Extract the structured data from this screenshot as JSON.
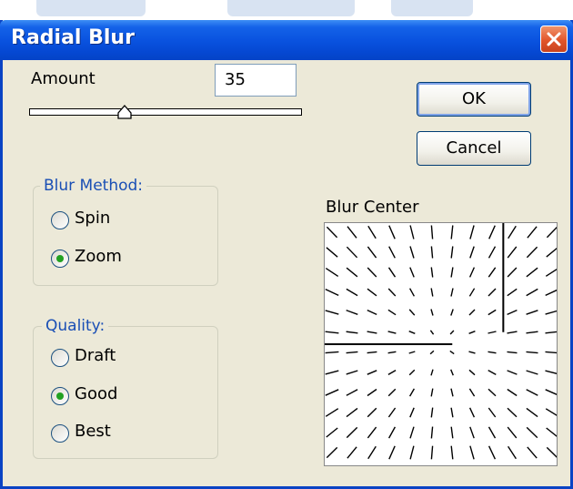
{
  "dialog": {
    "title": "Radial Blur",
    "amount_label": "Amount",
    "amount_value": "35",
    "amount_slider_value": 35,
    "amount_slider_max": 100,
    "ok_label": "OK",
    "cancel_label": "Cancel",
    "blur_method": {
      "legend": "Blur Method:",
      "options": [
        {
          "label": "Spin",
          "checked": false
        },
        {
          "label": "Zoom",
          "checked": true
        }
      ]
    },
    "quality": {
      "legend": "Quality:",
      "options": [
        {
          "label": "Draft",
          "checked": false
        },
        {
          "label": "Good",
          "checked": true
        },
        {
          "label": "Best",
          "checked": false
        }
      ]
    },
    "blur_center_label": "Blur Center"
  },
  "colors": {
    "titlebar": "#0a53e0",
    "dialog_bg": "#ece9d8",
    "legend_text": "#1a4fb5",
    "radio_checked": "#21a121",
    "close_button": "#e1552b"
  }
}
